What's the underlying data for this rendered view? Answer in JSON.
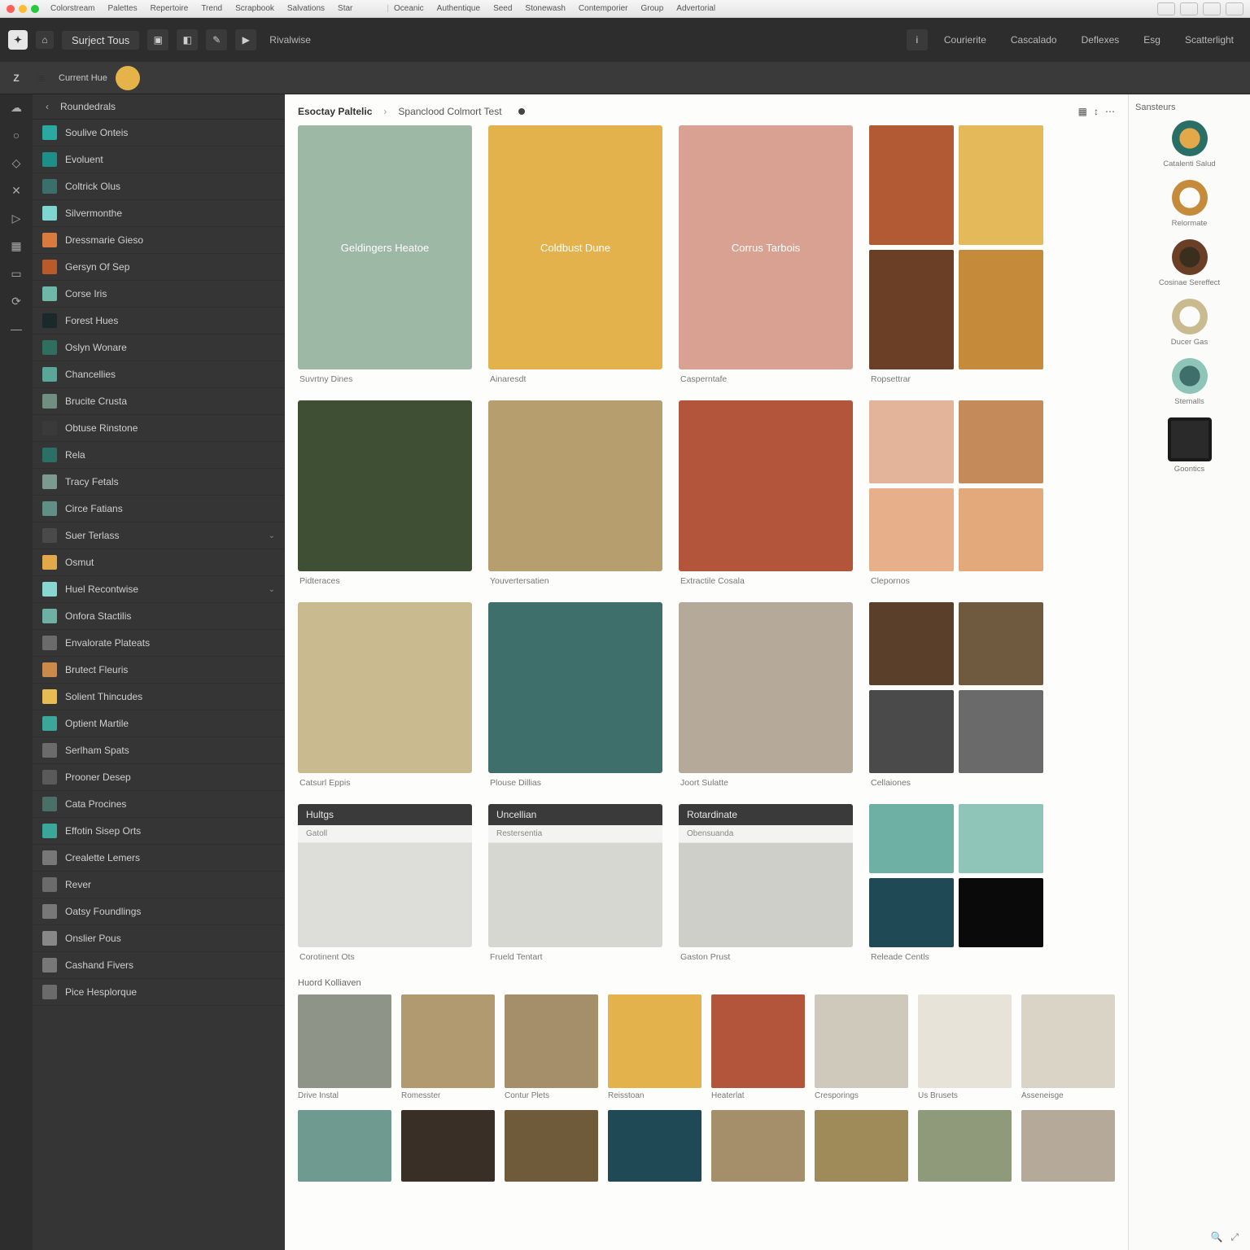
{
  "titlebar": {
    "menus": [
      "Colorstream",
      "Palettes",
      "Repertoire",
      "Trend",
      "Scrapbook",
      "Salvations",
      "Star"
    ],
    "secondary": [
      "Oceanic",
      "Authentique",
      "Seed",
      "Stonewash",
      "Contemporier",
      "Group",
      "Advertorial"
    ]
  },
  "header": {
    "home_icon": "home-icon",
    "title": "Surject Tous",
    "icon_buttons": [
      "bookmark-icon",
      "swatches-icon",
      "wand-icon",
      "play-icon"
    ],
    "crumb": "Rivalwise",
    "right_tabs": [
      "Courierite",
      "Cascalado",
      "Deflexes",
      "Esg",
      "Scatterlight"
    ]
  },
  "subheader": {
    "letter": "Z",
    "mini_icon": "layers-icon",
    "current_label": "Current Hue",
    "swatch_color": "#e6b24a"
  },
  "rail_icons": [
    "cloud-icon",
    "circle-icon",
    "diamond-icon",
    "x-icon",
    "grid-icon",
    "image-icon",
    "rect-icon",
    "loop-icon",
    "plus-icon"
  ],
  "sidebar": {
    "back_label": "Roundedrals",
    "items": [
      {
        "color": "#2aa9a0",
        "label": "Soulive Onteis"
      },
      {
        "color": "#1e8f88",
        "label": "Evoluent"
      },
      {
        "color": "#3b6f6b",
        "label": "Coltrick Olus"
      },
      {
        "color": "#7fd6d0",
        "label": "Silvermonthe"
      },
      {
        "color": "#d97b3f",
        "label": "Dressmarie Gieso"
      },
      {
        "color": "#b85a2a",
        "label": "Gersyn Of Sep"
      },
      {
        "color": "#6fb8a8",
        "label": "Corse Iris"
      },
      {
        "color": "#1a2a2a",
        "label": "Forest Hues"
      },
      {
        "color": "#2f6f5f",
        "label": "Oslyn Wonare"
      },
      {
        "color": "#5aa79a",
        "label": "Chancellies"
      },
      {
        "color": "#6f8f82",
        "label": "Brucite Crusta"
      },
      {
        "color": "#3a3a3a",
        "label": "Obtuse Rinstone"
      },
      {
        "color": "#2b6f66",
        "label": "Rela"
      },
      {
        "color": "#7c9a90",
        "label": "Tracy Fetals"
      },
      {
        "color": "#5f8f85",
        "label": "Circe Fatians"
      },
      {
        "color": "#4a4a4a",
        "label": "Suer Terlass"
      },
      {
        "color": "#e3a84a",
        "label": "Osmut"
      },
      {
        "color": "#88d8d0",
        "label": "Huel Recontwise"
      },
      {
        "color": "#6fb0a4",
        "label": "Onfora Stactilis"
      },
      {
        "color": "#6b6b6b",
        "label": "Envalorate Plateats"
      },
      {
        "color": "#c98a4a",
        "label": "Brutect Fleuris"
      },
      {
        "color": "#e8bc52",
        "label": "Solient Thincudes"
      },
      {
        "color": "#3aa79a",
        "label": "Optient Martile"
      },
      {
        "color": "#6b6b6b",
        "label": "Serlham Spats"
      },
      {
        "color": "#5a5a5a",
        "label": "Prooner Desep"
      },
      {
        "color": "#4a6f66",
        "label": "Cata Procines"
      },
      {
        "color": "#3aa79a",
        "label": "Effotin Sisep Orts"
      },
      {
        "color": "#787878",
        "label": "Crealette Lemers"
      },
      {
        "color": "#6b6b6b",
        "label": "Rever"
      },
      {
        "color": "#787878",
        "label": "Oatsy Foundlings"
      },
      {
        "color": "#888888",
        "label": "Onslier Pous"
      },
      {
        "color": "#787878",
        "label": "Cashand Fivers"
      },
      {
        "color": "#6b6b6b",
        "label": "Pice Hesplorque"
      }
    ]
  },
  "content": {
    "breadcrumb": "Esoctay Paltelic",
    "breadcrumb_sub": "Spanclood Colmort Test",
    "row1": [
      {
        "type": "big",
        "color": "#9db8a4",
        "label": "Geldingers Heatoe",
        "caption": "Suvrtny Dines"
      },
      {
        "type": "big",
        "color": "#e4b24d",
        "label": "Coldbust Dune",
        "caption": "Ainaresdt"
      },
      {
        "type": "big",
        "color": "#d9a191",
        "label": "Corrus Tarbois",
        "caption": "Casperntafe"
      },
      {
        "type": "grid",
        "caption": "Ropsettrar",
        "cells": [
          "#b15a33",
          "#e3b95a",
          "#6a3f26",
          "#c58a3a"
        ]
      }
    ],
    "row2": [
      {
        "type": "big",
        "color": "#3f4f33",
        "caption": "Pidteraces"
      },
      {
        "type": "big",
        "color": "#b79e6f",
        "caption": "Youvertersatien"
      },
      {
        "type": "big",
        "color": "#b3553a",
        "caption": "Extractile Cosala"
      },
      {
        "type": "grid",
        "caption": "Clepornos",
        "cells": [
          "#e3b49a",
          "#c58a5a",
          "#e7b08a",
          "#e3a97a"
        ]
      }
    ],
    "row3": [
      {
        "type": "big",
        "color": "#c9bb8f",
        "caption": "Catsurl Eppis"
      },
      {
        "type": "big",
        "color": "#3f6f6a",
        "caption": "Plouse Dillias"
      },
      {
        "type": "big",
        "color": "#b5aa9a",
        "caption": "Joort Sulatte"
      },
      {
        "type": "grid",
        "caption": "Cellaiones",
        "cells": [
          "#5a3f2a",
          "#6f5a3f",
          "#4a4a4a",
          "#6a6a6a"
        ]
      }
    ],
    "row4_headers": [
      {
        "title": "Hultgs",
        "sub": "Gatoll",
        "body": "#ddddd9",
        "foot": "Corotinent Ots"
      },
      {
        "title": "Uncellian",
        "sub": "Restersentia",
        "body": "#d7d7d2",
        "foot": "Frueld Tentart"
      },
      {
        "title": "Rotardinate",
        "sub": "Obensuanda",
        "body": "#cfcfca",
        "foot": "Gaston Prust"
      },
      {
        "title": "grid",
        "cells": [
          "#6fb0a4",
          "#8fc4b8",
          "#1f4a55",
          "#0a0a0a"
        ],
        "foot": "Releade Centls"
      }
    ],
    "section_label": "Huord Kolliaven",
    "row5": [
      {
        "color": "#8f9488",
        "caption": "Drive Instal"
      },
      {
        "color": "#b19a6f",
        "caption": "Romesster"
      },
      {
        "color": "#a48f6a",
        "caption": "Contur Plets"
      },
      {
        "color": "#e3b24d",
        "caption": "Reisstoan"
      },
      {
        "color": "#b3553a",
        "caption": "Heaterlat"
      },
      {
        "color": "#cfc9bb",
        "caption": "Cresporings"
      },
      {
        "color": "#e7e3d8",
        "caption": "Us Brusets"
      },
      {
        "color": "#d9d4c6",
        "caption": "Asseneisge"
      }
    ],
    "row6": [
      "#6f9a8f",
      "#3a2f26",
      "#6f5a3a",
      "#1f4a55",
      "#a48f6a",
      "#9f8a5a",
      "#8f9a7a",
      "#b5aa9a"
    ]
  },
  "rightpanel": {
    "title": "Sansteurs",
    "items": [
      {
        "kind": "donut",
        "outer": "#2a6f66",
        "inner": "#e3a84a",
        "caption": "Catalenti Salud"
      },
      {
        "kind": "donut",
        "outer": "#c58a3a",
        "inner": "#fbfbfa",
        "caption": "Relormate"
      },
      {
        "kind": "donut",
        "outer": "#6a3f26",
        "inner": "#3a2f1f",
        "caption": "Cosinae Sereffect"
      },
      {
        "kind": "donut",
        "outer": "#c9bb8f",
        "inner": "#fbfbfa",
        "caption": "Ducer Gas"
      },
      {
        "kind": "donut",
        "outer": "#8fc4b8",
        "inner": "#3f6f6a",
        "caption": "Stemalls"
      },
      {
        "kind": "square",
        "border": "#1a1a1a",
        "fill": "#2a2a2a",
        "caption": "Goontics"
      }
    ]
  }
}
